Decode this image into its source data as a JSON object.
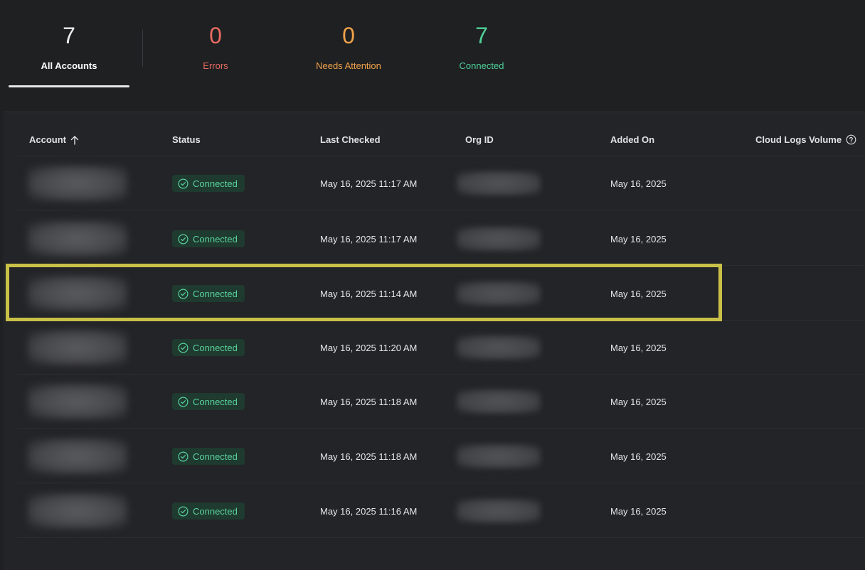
{
  "summary": {
    "all": {
      "count": "7",
      "label": "All Accounts"
    },
    "errors": {
      "count": "0",
      "label": "Errors"
    },
    "attention": {
      "count": "0",
      "label": "Needs Attention"
    },
    "connected": {
      "count": "7",
      "label": "Connected"
    }
  },
  "table": {
    "headers": {
      "account": "Account",
      "status": "Status",
      "last_checked": "Last Checked",
      "org_id": "Org ID",
      "added_on": "Added On",
      "cloud_logs_volume": "Cloud Logs Volume"
    },
    "rows": [
      {
        "status": "Connected",
        "last_checked": "May 16, 2025 11:17 AM",
        "added_on": "May 16, 2025"
      },
      {
        "status": "Connected",
        "last_checked": "May 16, 2025 11:17 AM",
        "added_on": "May 16, 2025"
      },
      {
        "status": "Connected",
        "last_checked": "May 16, 2025 11:14 AM",
        "added_on": "May 16, 2025"
      },
      {
        "status": "Connected",
        "last_checked": "May 16, 2025 11:20 AM",
        "added_on": "May 16, 2025"
      },
      {
        "status": "Connected",
        "last_checked": "May 16, 2025 11:18 AM",
        "added_on": "May 16, 2025"
      },
      {
        "status": "Connected",
        "last_checked": "May 16, 2025 11:18 AM",
        "added_on": "May 16, 2025"
      },
      {
        "status": "Connected",
        "last_checked": "May 16, 2025 11:16 AM",
        "added_on": "May 16, 2025"
      }
    ]
  },
  "colors": {
    "error": "#e86b62",
    "attention": "#f0a24a",
    "connected": "#4ed39a",
    "highlight": "#c9c048"
  },
  "icons": {
    "sort": "arrow-up-icon",
    "help": "question-circle-icon",
    "status": "check-circle-icon"
  }
}
